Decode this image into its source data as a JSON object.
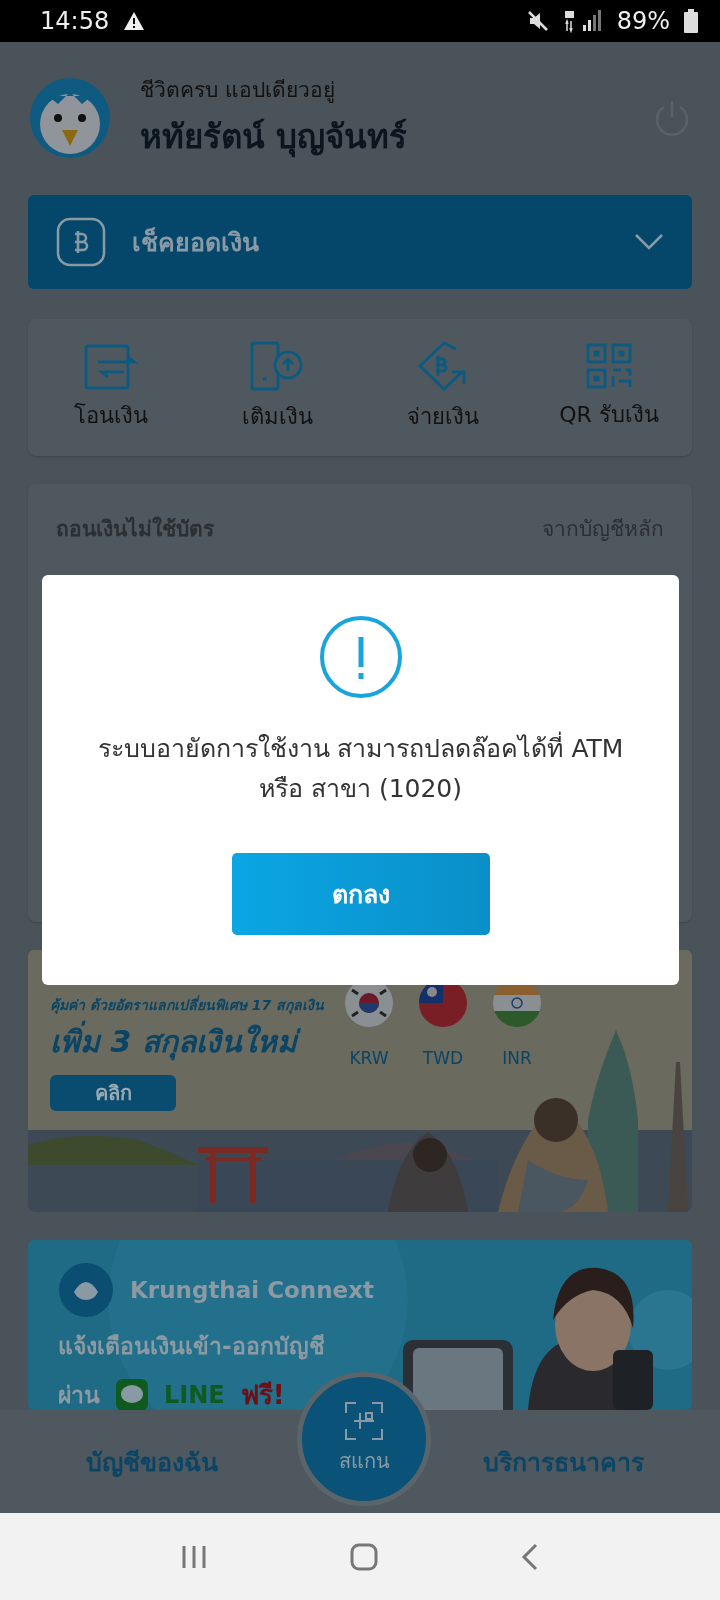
{
  "status_bar": {
    "time": "14:58",
    "battery": "89%"
  },
  "header": {
    "tagline": "ชีวิตครบ แอปเดียวอยู่",
    "name": "หทัยรัตน์ บุญจันทร์"
  },
  "balance_bar": {
    "label": "เช็คยอดเงิน"
  },
  "quick_actions": [
    {
      "label": "โอนเงิน",
      "kind": "transfer"
    },
    {
      "label": "เติมเงิน",
      "kind": "topup"
    },
    {
      "label": "จ่ายเงิน",
      "kind": "pay"
    },
    {
      "label": "QR รับเงิน",
      "kind": "qr"
    }
  ],
  "withdraw_card": {
    "title": "ถอนเงินไม่ใช้บัตร",
    "source": "จากบัญชีหลัก"
  },
  "travel_banner": {
    "subtitle": "คุ้มค่า ด้วยอัตราแลกเปลี่ยนพิเศษ 17 สกุลเงิน",
    "headline": "เพิ่ม 3 สกุลเงินใหม่",
    "button": "คลิก",
    "currencies": [
      {
        "code": "KRW",
        "kind": "kr"
      },
      {
        "code": "TWD",
        "kind": "tw"
      },
      {
        "code": "INR",
        "kind": "in"
      }
    ]
  },
  "connext_banner": {
    "title": "Krungthai Connext",
    "line1": "แจ้งเตือนเงินเข้า-ออกบัญชี",
    "via": "ผ่าน",
    "app": "LINE",
    "free": "ฟรี!"
  },
  "dialog": {
    "message": "ระบบอายัดการใช้งาน สามารถปลดล๊อคได้ที่ ATM หรือ สาขา (1020)",
    "button": "ตกลง"
  },
  "bottom_nav": {
    "left": "บัญชีของฉัน",
    "scan": "สแกน",
    "right": "บริการธนาคาร"
  }
}
